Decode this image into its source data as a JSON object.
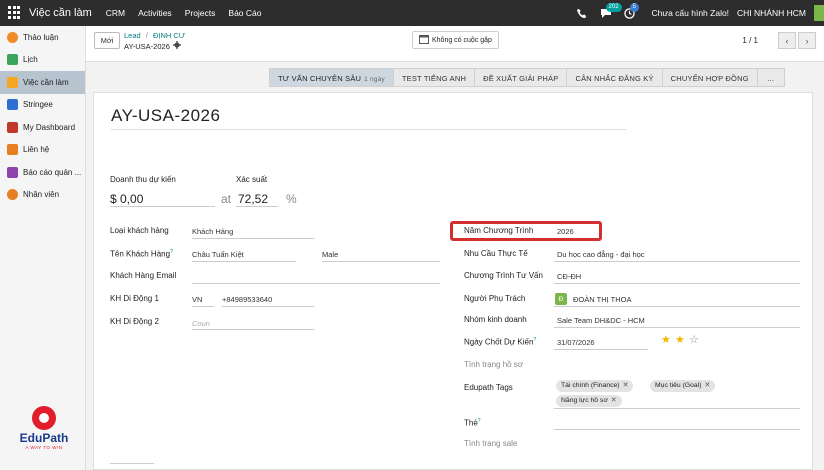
{
  "topbar": {
    "app_title": "Việc cần làm",
    "menu": [
      "CRM",
      "Activities",
      "Projects",
      "Báo Cáo"
    ],
    "chat_badge": "202",
    "activity_badge": "5",
    "zalo_status": "Chưa cấu hình Zalo!",
    "company": "CHI NHÁNH HCM"
  },
  "sidebar": {
    "items": [
      {
        "label": "Thảo luận",
        "icon": "chat-icon",
        "color": "#f08a24"
      },
      {
        "label": "Lịch",
        "icon": "calendar-icon",
        "color": "#3ba55d"
      },
      {
        "label": "Việc cần làm",
        "icon": "checklist-icon",
        "color": "#f5a623"
      },
      {
        "label": "Stringee",
        "icon": "stringee-icon",
        "color": "#2f6fd1"
      },
      {
        "label": "My Dashboard",
        "icon": "dashboard-icon",
        "color": "#c0392b"
      },
      {
        "label": "Liên hệ",
        "icon": "contact-icon",
        "color": "#e67e22"
      },
      {
        "label": "Báo cáo quản ...",
        "icon": "report-icon",
        "color": "#8e44ad"
      },
      {
        "label": "Nhân viên",
        "icon": "employee-icon",
        "color": "#e67e22"
      }
    ],
    "brand_name": "EduPath",
    "brand_tag": "A WAY TO WIN"
  },
  "control": {
    "new_button": "Mới",
    "breadcrumb_parent": "Lead",
    "breadcrumb_sep": "/",
    "breadcrumb_stage": "ĐỊNH CƯ",
    "breadcrumb_current": "AY-USA-2026",
    "no_schedule": "Không có cuộc gặp",
    "pager": "1 / 1"
  },
  "stages": [
    {
      "label": "TƯ VẤN CHUYÊN SÂU",
      "sub": "1 ngày",
      "active": true
    },
    {
      "label": "TEST TIẾNG ANH",
      "sub": ""
    },
    {
      "label": "ĐỀ XUẤT GIẢI PHÁP",
      "sub": ""
    },
    {
      "label": "CÂN NHẮC ĐĂNG KÝ",
      "sub": ""
    },
    {
      "label": "CHUYỂN HỢP ĐỒNG",
      "sub": ""
    },
    {
      "label": "...",
      "sub": ""
    }
  ],
  "form": {
    "title": "AY-USA-2026",
    "revenue_label": "Doanh thu dự kiến",
    "revenue_value": "$ 0,00",
    "at": "at",
    "probability_label": "Xác suất",
    "probability_value": "72,52",
    "percent": "%",
    "left": {
      "customer_type_label": "Loại khách hàng",
      "customer_type_value": "Khách Hàng",
      "customer_name_label": "Tên Khách Hàng",
      "customer_name_value": "Châu Tuấn Kiệt",
      "gender_value": "Male",
      "email_label": "Khách Hàng Email",
      "mobile1_label": "KH Di Động 1",
      "mobile1_country": "VN",
      "mobile1_value": "+84989533640",
      "mobile2_label": "KH Di Động 2",
      "mobile2_placeholder": "Coun"
    },
    "right": {
      "program_year_label": "Năm Chương Trình",
      "program_year_value": "2026",
      "real_need_label": "Nhu Cầu Thực Tế",
      "real_need_value": "Du học cao đẳng - đại học",
      "consult_program_label": "Chương Trình Tư Vấn",
      "consult_program_value": "CĐ-ĐH",
      "owner_label": "Người Phụ Trách",
      "owner_initial": "Đ",
      "owner_value": "ĐOÀN THỊ THOA",
      "team_label": "Nhóm kinh doanh",
      "team_value": "Sale Team DH&DC - HCM",
      "close_date_label": "Ngày Chốt Dự Kiến",
      "close_date_value": "31/07/2026",
      "priority_stars": 2,
      "profile_status_label": "Tình trạng hồ sơ",
      "tags_label": "Edupath Tags",
      "tags": [
        "Tài chính (Finance)",
        "Mục tiêu (Goal)",
        "Năng lực hồ sơ"
      ],
      "the_label": "Thẻ",
      "sale_status_label": "Tình trạng sale"
    }
  }
}
